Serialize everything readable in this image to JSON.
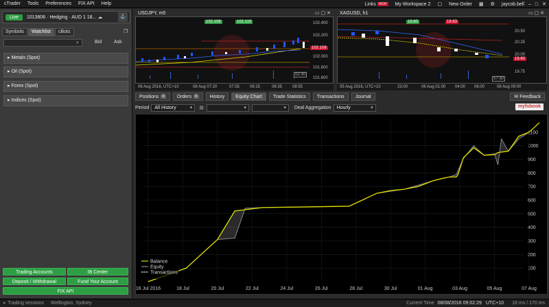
{
  "menu": {
    "items": [
      "cTrader",
      "Tools",
      "Preferences",
      "FIX API",
      "Help"
    ],
    "links": "Links",
    "new_badge": "NEW",
    "workspace": "My Workspace 2",
    "new_order": "New Order",
    "user": "jaycob.bell"
  },
  "account": {
    "live_label": "Live",
    "info": "1013806 · Hedging · AUD 1 18..."
  },
  "left_tabs": [
    "Symbols",
    "Watchlist",
    "cBots"
  ],
  "symbols": {
    "bid": "Bid",
    "ask": "Ask",
    "groups": [
      "Metals (Spot)",
      "Oil (Spot)",
      "Forex (Spot)",
      "Indices (Spot)"
    ]
  },
  "left_buttons": {
    "trading_accounts": "Trading Accounts",
    "ib_center": "IB Center",
    "deposit": "Deposit / Withdrawal",
    "fund": "Fund Your Account",
    "fix": "FIX API"
  },
  "chart1": {
    "title": "USDJPY, m5",
    "sell": "102.108",
    "buy": "102.110",
    "price_tag": "102.108",
    "axis": [
      "102.400",
      "102.200",
      "102.000",
      "101.800",
      "101.600"
    ],
    "times": [
      "06 Aug 2016, UTC+10",
      "08 Aug 07:20",
      "07:55",
      "08:15",
      "08:35",
      "08:55"
    ],
    "timer": "02:30"
  },
  "chart2": {
    "title": "XAGUSD, h1",
    "sell": "19.60",
    "buy": "19.63",
    "price_tag": "19.60",
    "axis": [
      "20.50",
      "20.25",
      "20.00",
      "19.75"
    ],
    "times": [
      "05 Aug 2016, UTC+10",
      "23:00",
      "06 Aug 01:00",
      "04:00",
      "06:00",
      "08 Aug 09:00"
    ],
    "timer": "57:30"
  },
  "bottom_tabs": [
    {
      "label": "Positions",
      "count": "0"
    },
    {
      "label": "Orders",
      "count": "0"
    },
    {
      "label": "History"
    },
    {
      "label": "Equity Chart"
    },
    {
      "label": "Trade Statistics"
    },
    {
      "label": "Transactions"
    },
    {
      "label": "Journal"
    }
  ],
  "feedback": "Feedback",
  "filters": {
    "period_label": "Period",
    "period": "All History",
    "aggregation_label": "Deal Aggregation",
    "aggregation": "Hourly",
    "mybook": "myfxbook"
  },
  "status": {
    "sessions": "Trading sessions",
    "location": "Wellington, Sydney",
    "current_time_label": "Current Time",
    "current_time": "08/08/2016 09:02:29",
    "tz": "UTC+10",
    "latency": "18 ms / 170 ms"
  },
  "colors": {
    "green": "#2e9e44",
    "red": "#c8102e",
    "balance": "#e0e000",
    "equity": "#888888"
  },
  "chart_data": {
    "type": "line",
    "x": [
      "16 Jul 2016",
      "18 Jul",
      "20 Jul",
      "22 Jul",
      "24 Jul",
      "26 Jul",
      "28 Jul",
      "30 Jul",
      "01 Aug",
      "03 Aug",
      "05 Aug",
      "07 Aug"
    ],
    "ylim": [
      0,
      1200
    ],
    "yticks": [
      100,
      200,
      300,
      400,
      500,
      600,
      700,
      800,
      900,
      1000,
      1100
    ],
    "legend": [
      "Balance",
      "Equity",
      "Transactions"
    ],
    "legend_position": "bottom-left",
    "series": [
      {
        "name": "Balance",
        "x": [
          0,
          1.1,
          2,
          2.5,
          3.3,
          4.6,
          5.8,
          6.1,
          6.6,
          7,
          7.4,
          7.8,
          8.2,
          8.5,
          8.7,
          8.9,
          8.95,
          9.1,
          9.4,
          9.7,
          10,
          10.1,
          10.4,
          10.7,
          11,
          11.3
        ],
        "y": [
          0,
          100,
          310,
          520,
          545,
          550,
          555,
          590,
          650,
          670,
          680,
          700,
          740,
          760,
          770,
          770,
          790,
          910,
          985,
          930,
          935,
          950,
          960,
          1070,
          1100,
          1170
        ]
      },
      {
        "name": "Equity",
        "x": [
          0,
          1.1,
          2,
          2.5,
          2.8,
          3.3,
          4.6,
          5.8,
          6.6,
          7.4,
          8.2,
          8.7,
          8.9,
          9.1,
          9.4,
          9.7,
          10,
          10.1,
          10.2,
          10.4,
          10.7,
          11,
          11.3
        ],
        "y": [
          0,
          100,
          310,
          320,
          540,
          545,
          550,
          555,
          650,
          680,
          740,
          770,
          790,
          905,
          1000,
          930,
          940,
          860,
          1050,
          960,
          1050,
          1100,
          1170
        ]
      }
    ]
  }
}
